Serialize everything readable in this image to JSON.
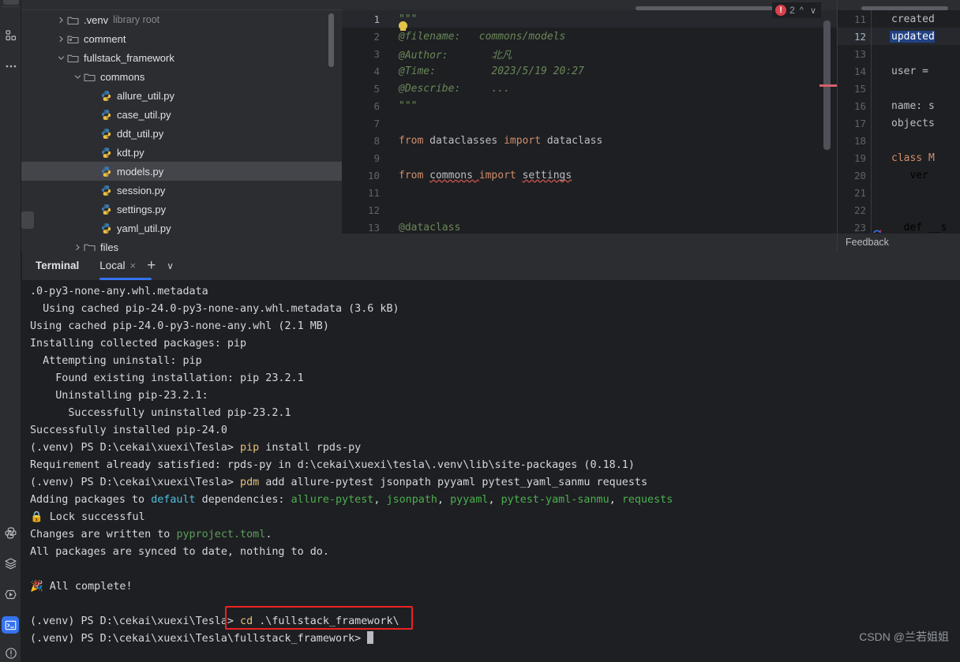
{
  "activity_bar": {
    "icons": [
      {
        "name": "project-structure-icon",
        "label": "Project"
      },
      {
        "name": "more-options-icon",
        "label": "More"
      },
      {
        "name": "python-console-icon",
        "label": "Python Console"
      },
      {
        "name": "services-icon",
        "label": "Services"
      },
      {
        "name": "run-icon",
        "label": "Run"
      },
      {
        "name": "terminal-icon",
        "label": "Terminal",
        "active": true
      },
      {
        "name": "problems-icon",
        "label": "Problems"
      }
    ]
  },
  "project_tree": {
    "items": [
      {
        "label": ".venv",
        "sub": "library root",
        "icon": "folder-icon",
        "chevron": "right",
        "indent": 0,
        "selected": false
      },
      {
        "label": "comment",
        "sub": "",
        "icon": "folder-module-icon",
        "chevron": "right",
        "indent": 0,
        "selected": false
      },
      {
        "label": "fullstack_framework",
        "sub": "",
        "icon": "folder-icon",
        "chevron": "down",
        "indent": 0,
        "selected": false
      },
      {
        "label": "commons",
        "sub": "",
        "icon": "folder-icon",
        "chevron": "down",
        "indent": 1,
        "selected": false
      },
      {
        "label": "allure_util.py",
        "sub": "",
        "icon": "python-file-icon",
        "chevron": "none",
        "indent": 2,
        "selected": false
      },
      {
        "label": "case_util.py",
        "sub": "",
        "icon": "python-file-icon",
        "chevron": "none",
        "indent": 2,
        "selected": false
      },
      {
        "label": "ddt_util.py",
        "sub": "",
        "icon": "python-file-icon",
        "chevron": "none",
        "indent": 2,
        "selected": false
      },
      {
        "label": "kdt.py",
        "sub": "",
        "icon": "python-file-icon",
        "chevron": "none",
        "indent": 2,
        "selected": false
      },
      {
        "label": "models.py",
        "sub": "",
        "icon": "python-file-icon",
        "chevron": "none",
        "indent": 2,
        "selected": true
      },
      {
        "label": "session.py",
        "sub": "",
        "icon": "python-file-icon",
        "chevron": "none",
        "indent": 2,
        "selected": false
      },
      {
        "label": "settings.py",
        "sub": "",
        "icon": "python-file-icon",
        "chevron": "none",
        "indent": 2,
        "selected": false
      },
      {
        "label": "yaml_util.py",
        "sub": "",
        "icon": "python-file-icon",
        "chevron": "none",
        "indent": 2,
        "selected": false
      },
      {
        "label": "files",
        "sub": "",
        "icon": "folder-icon",
        "chevron": "right",
        "indent": 1,
        "selected": false
      }
    ]
  },
  "editor": {
    "error_count": "2",
    "lines": [
      {
        "num": "1",
        "current": true,
        "segments": [
          {
            "text": "\"\"\"",
            "cls": "tok-docstr"
          }
        ]
      },
      {
        "num": "2",
        "current": false,
        "segments": [
          {
            "text": "@filename:   commons/models",
            "cls": "tok-docstr"
          }
        ]
      },
      {
        "num": "3",
        "current": false,
        "segments": [
          {
            "text": "@Author:       北凡",
            "cls": "tok-docstr"
          }
        ]
      },
      {
        "num": "4",
        "current": false,
        "segments": [
          {
            "text": "@Time:         2023/5/19 20:27",
            "cls": "tok-docstr"
          }
        ]
      },
      {
        "num": "5",
        "current": false,
        "segments": [
          {
            "text": "@Describe:     ...",
            "cls": "tok-docstr"
          }
        ]
      },
      {
        "num": "6",
        "current": false,
        "segments": [
          {
            "text": "\"\"\"",
            "cls": "tok-docstr"
          }
        ]
      },
      {
        "num": "7",
        "current": false,
        "segments": []
      },
      {
        "num": "8",
        "current": false,
        "segments": [
          {
            "text": "from ",
            "cls": "tok-kw"
          },
          {
            "text": "dataclasses ",
            "cls": "tok-plain"
          },
          {
            "text": "import ",
            "cls": "tok-kw"
          },
          {
            "text": "dataclass",
            "cls": "tok-plain"
          }
        ]
      },
      {
        "num": "9",
        "current": false,
        "segments": []
      },
      {
        "num": "10",
        "current": false,
        "segments": [
          {
            "text": "from ",
            "cls": "tok-kw"
          },
          {
            "text": "commons ",
            "cls": "tok-plain squiggle"
          },
          {
            "text": "import ",
            "cls": "tok-kw"
          },
          {
            "text": "settings",
            "cls": "tok-plain squiggle"
          }
        ]
      },
      {
        "num": "11",
        "current": false,
        "segments": []
      },
      {
        "num": "12",
        "current": false,
        "segments": []
      },
      {
        "num": "13",
        "current": false,
        "segments": [
          {
            "text": "@dataclass",
            "cls": "tok-green"
          }
        ]
      }
    ]
  },
  "right_pane": {
    "feedback_label": "Feedback",
    "lines": [
      {
        "num": "11",
        "current": false,
        "code": "created",
        "highlight": false
      },
      {
        "num": "12",
        "current": true,
        "code": "updated",
        "highlight": true
      },
      {
        "num": "13",
        "current": false,
        "code": "",
        "highlight": false
      },
      {
        "num": "14",
        "current": false,
        "code": "user = ",
        "highlight": false
      },
      {
        "num": "15",
        "current": false,
        "code": "",
        "highlight": false
      },
      {
        "num": "16",
        "current": false,
        "code": "name: s",
        "highlight": false
      },
      {
        "num": "17",
        "current": false,
        "code": "objects",
        "highlight": false
      },
      {
        "num": "18",
        "current": false,
        "code": "",
        "highlight": false
      },
      {
        "num": "19",
        "current": false,
        "code": "class M",
        "highlight": false
      },
      {
        "num": "20",
        "current": false,
        "code": "   ver",
        "highlight": false
      },
      {
        "num": "21",
        "current": false,
        "code": "",
        "highlight": false
      },
      {
        "num": "22",
        "current": false,
        "code": "",
        "highlight": false
      },
      {
        "num": "23",
        "current": false,
        "code": "  def __s",
        "highlight": false
      }
    ]
  },
  "terminal": {
    "title": "Terminal",
    "tab_label": "Local",
    "close_glyph": "×",
    "plus_glyph": "+",
    "chevron_glyph": "∨",
    "lines": [
      {
        "segments": [
          {
            "text": ".0-py3-none-any.whl.metadata",
            "cls": "t-white"
          }
        ]
      },
      {
        "segments": [
          {
            "text": "  Using cached pip-24.0-py3-none-any.whl.metadata (3.6 kB)",
            "cls": "t-white"
          }
        ]
      },
      {
        "segments": [
          {
            "text": "Using cached pip-24.0-py3-none-any.whl (2.1 MB)",
            "cls": "t-white"
          }
        ]
      },
      {
        "segments": [
          {
            "text": "Installing collected packages: pip",
            "cls": "t-white"
          }
        ]
      },
      {
        "segments": [
          {
            "text": "  Attempting uninstall: pip",
            "cls": "t-white"
          }
        ]
      },
      {
        "segments": [
          {
            "text": "    Found existing installation: pip 23.2.1",
            "cls": "t-white"
          }
        ]
      },
      {
        "segments": [
          {
            "text": "    Uninstalling pip-23.2.1:",
            "cls": "t-white"
          }
        ]
      },
      {
        "segments": [
          {
            "text": "      Successfully uninstalled pip-23.2.1",
            "cls": "t-white"
          }
        ]
      },
      {
        "segments": [
          {
            "text": "Successfully installed pip-24.0",
            "cls": "t-white"
          }
        ]
      },
      {
        "segments": [
          {
            "text": "(.venv) PS D:\\cekai\\xuexi\\Tesla> ",
            "cls": "t-white"
          },
          {
            "text": "pip",
            "cls": "t-yellow"
          },
          {
            "text": " install rpds-py",
            "cls": "t-white"
          }
        ]
      },
      {
        "segments": [
          {
            "text": "Requirement already satisfied: rpds-py in d:\\cekai\\xuexi\\tesla\\.venv\\lib\\site-packages (0.18.1)",
            "cls": "t-white"
          }
        ]
      },
      {
        "segments": [
          {
            "text": "(.venv) PS D:\\cekai\\xuexi\\Tesla> ",
            "cls": "t-white"
          },
          {
            "text": "pdm",
            "cls": "t-yellow"
          },
          {
            "text": " add allure-pytest jsonpath pyyaml pytest_yaml_sanmu requests",
            "cls": "t-white"
          }
        ]
      },
      {
        "segments": [
          {
            "text": "Adding packages to ",
            "cls": "t-white"
          },
          {
            "text": "default",
            "cls": "t-cyan"
          },
          {
            "text": " dependencies: ",
            "cls": "t-white"
          },
          {
            "text": "allure-pytest",
            "cls": "t-green"
          },
          {
            "text": ", ",
            "cls": "t-white"
          },
          {
            "text": "jsonpath",
            "cls": "t-green"
          },
          {
            "text": ", ",
            "cls": "t-white"
          },
          {
            "text": "pyyaml",
            "cls": "t-green"
          },
          {
            "text": ", ",
            "cls": "t-white"
          },
          {
            "text": "pytest-yaml-sanmu",
            "cls": "t-green"
          },
          {
            "text": ", ",
            "cls": "t-white"
          },
          {
            "text": "requests",
            "cls": "t-green"
          }
        ]
      },
      {
        "segments": [
          {
            "text": "🔒",
            "cls": "lock-emoji"
          },
          {
            "text": " Lock successful",
            "cls": "t-white"
          }
        ]
      },
      {
        "segments": [
          {
            "text": "Changes are written to ",
            "cls": "t-white"
          },
          {
            "text": "pyproject.toml",
            "cls": "t-darkgreen"
          },
          {
            "text": ".",
            "cls": "t-white"
          }
        ]
      },
      {
        "segments": [
          {
            "text": "All packages are synced to date, nothing to do.",
            "cls": "t-white"
          }
        ]
      },
      {
        "segments": []
      },
      {
        "segments": [
          {
            "text": "🎉",
            "cls": "party-emoji"
          },
          {
            "text": " All complete!",
            "cls": "t-white"
          }
        ]
      },
      {
        "segments": []
      },
      {
        "segments": [
          {
            "text": "(.venv) PS D:\\cekai\\xuexi\\Tesla> ",
            "cls": "t-white"
          },
          {
            "text": "cd",
            "cls": "t-yellow"
          },
          {
            "text": " .\\fullstack_framework\\",
            "cls": "t-white"
          }
        ]
      },
      {
        "segments": [
          {
            "text": "(.venv) PS D:\\cekai\\xuexi\\Tesla\\fullstack_framework> ",
            "cls": "t-white"
          }
        ],
        "cursor": true
      }
    ]
  },
  "highlight_box": {
    "name": "cd-command-highlight",
    "color": "#ee2222"
  },
  "watermark": {
    "text": "CSDN @兰若姐姐"
  }
}
